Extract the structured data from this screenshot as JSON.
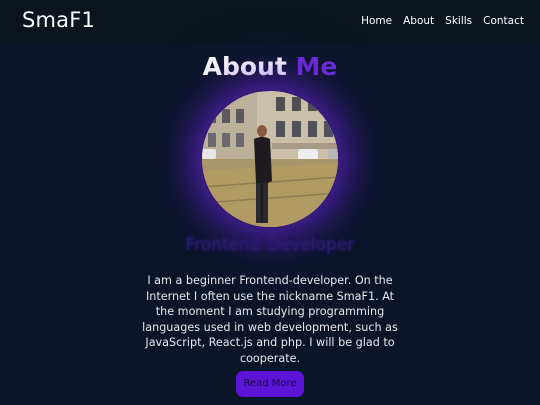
{
  "header": {
    "logo": "SmaF1",
    "nav": [
      "Home",
      "About",
      "Skills",
      "Contact"
    ]
  },
  "about": {
    "title_main": "About",
    "title_accent": "Me",
    "role": "Frontend-Developer",
    "text": "I am a beginner Frontend-developer. On the Internet I often use the nickname SmaF1. At the moment I am studying programming languages used in web development, such as JavaScript, React.js and php. I will be glad to cooperate.",
    "button_label": "Read More"
  },
  "colors": {
    "background": "#0a1627",
    "navbar": "#0b141f",
    "accent": "#6a2ed6",
    "button": "#5c14d6"
  }
}
